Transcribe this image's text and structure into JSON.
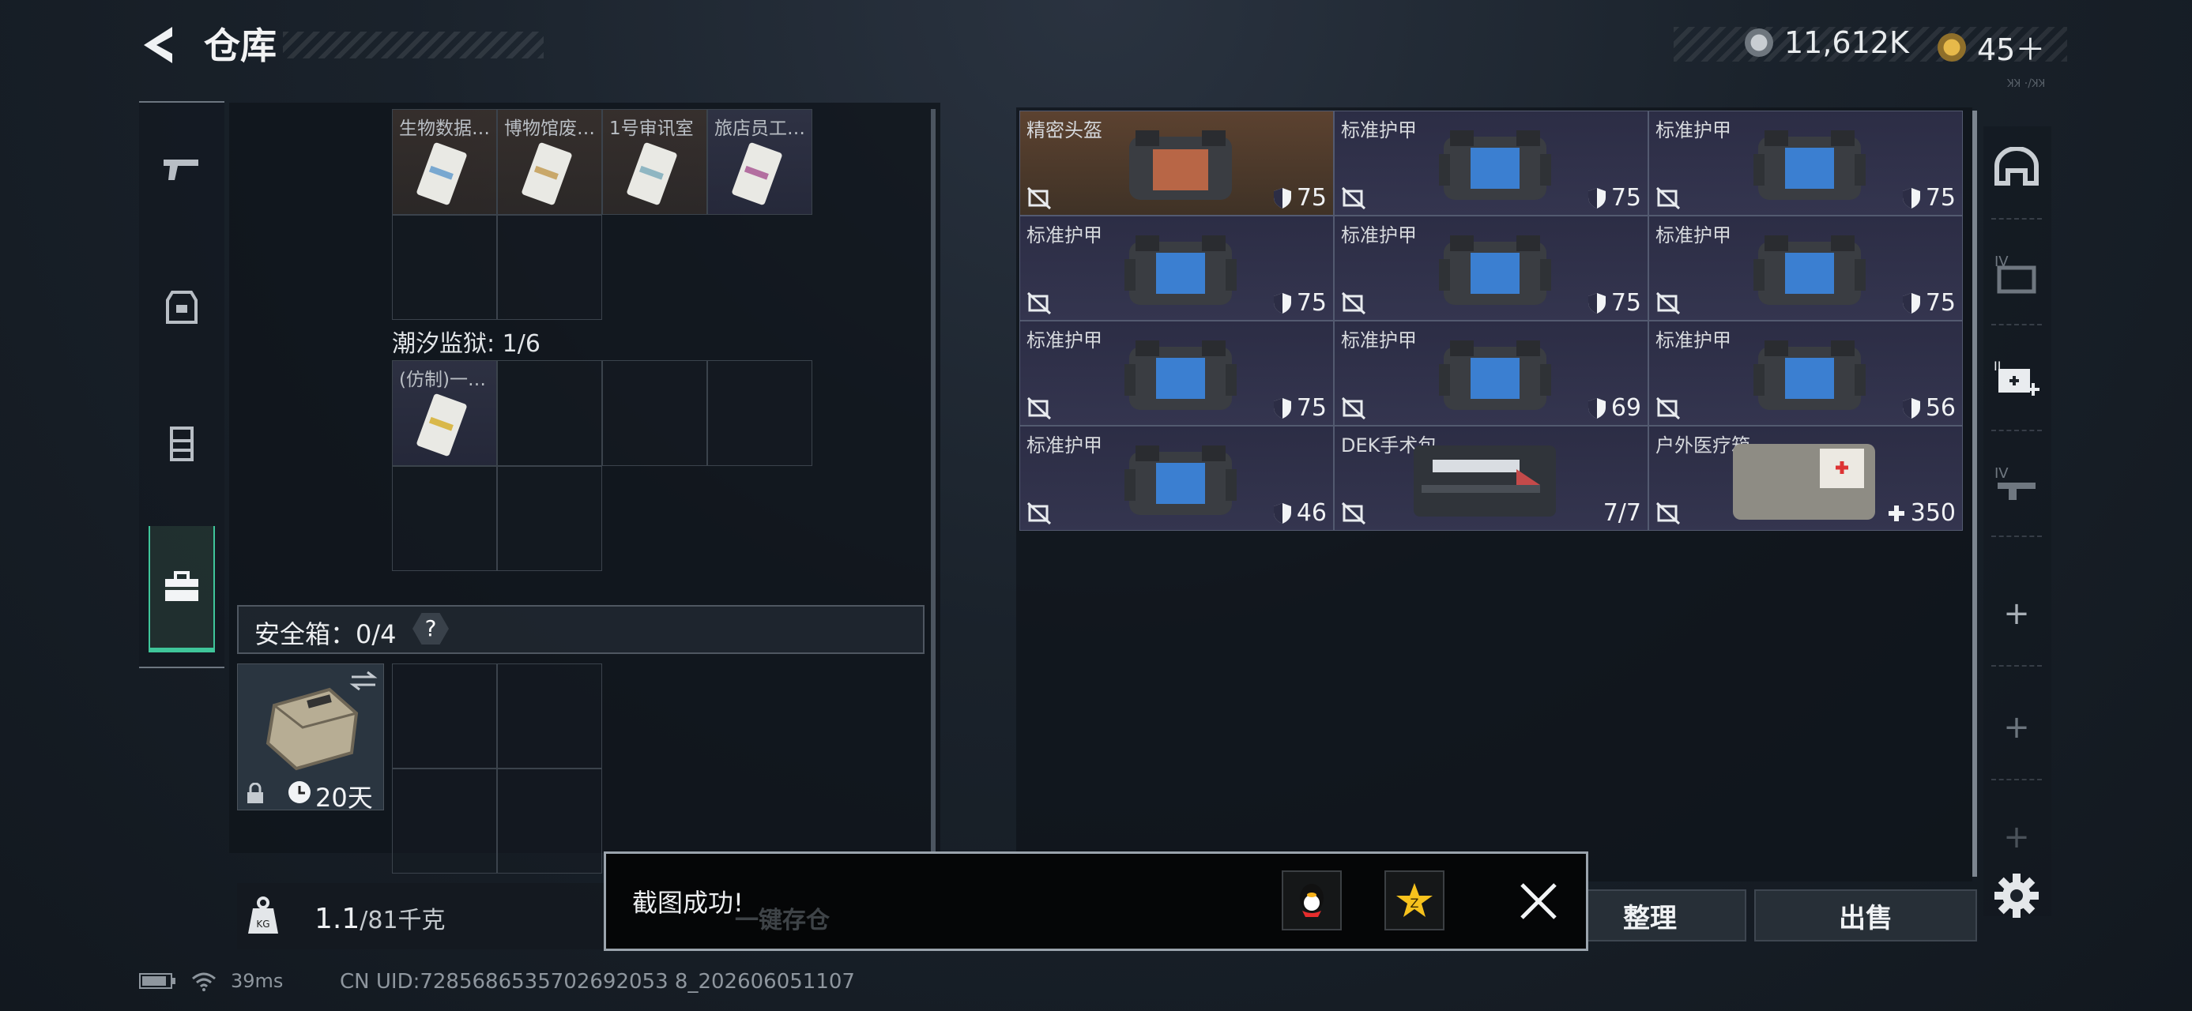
{
  "header": {
    "title": "仓库"
  },
  "currency": {
    "primary": "11,612K",
    "secondary": "45＋"
  },
  "corner_text": "ꞰꞰ ·/ꞰꞰ",
  "nav": {
    "items": [
      "pistol-icon",
      "backpack-icon",
      "chest-rig-icon",
      "toolbox-icon"
    ],
    "active": 3
  },
  "left_panel": {
    "key_cards": [
      "生物数据…",
      "博物馆废…",
      "1号审讯室",
      "旅店员工…"
    ],
    "section2_label": "潮汐监狱: 1/6",
    "section2_cards": [
      "(仿制)一…"
    ],
    "safe_label": "安全箱：0/4",
    "safe_help": "?",
    "safe_duration": "20天",
    "weight_value": "1.1",
    "weight_unit": "/81千克"
  },
  "inventory": [
    {
      "name": "精密头盔",
      "value": "75",
      "type": "helmet"
    },
    {
      "name": "标准护甲",
      "value": "75",
      "type": "armor"
    },
    {
      "name": "标准护甲",
      "value": "75",
      "type": "armor"
    },
    {
      "name": "标准护甲",
      "value": "75",
      "type": "armor"
    },
    {
      "name": "标准护甲",
      "value": "75",
      "type": "armor"
    },
    {
      "name": "标准护甲",
      "value": "75",
      "type": "armor"
    },
    {
      "name": "标准护甲",
      "value": "75",
      "type": "armor"
    },
    {
      "name": "标准护甲",
      "value": "69",
      "type": "armor"
    },
    {
      "name": "标准护甲",
      "value": "56",
      "type": "armor"
    },
    {
      "name": "标准护甲",
      "value": "46",
      "type": "armor"
    },
    {
      "name": "DEK手术包",
      "value": "7/7",
      "type": "medkit"
    },
    {
      "name": "户外医疗箱",
      "value": "350",
      "type": "medbox"
    }
  ],
  "buttons": {
    "sort": "整理",
    "sell": "出售"
  },
  "toast": {
    "message": "截图成功!",
    "ghost": "一键存仓"
  },
  "status": {
    "ping": "39ms",
    "uid": "CN UID:7285686535702692053 8_202606051107"
  },
  "colors": {
    "accent": "#3fc59a",
    "helmet_bg": "#5c4230",
    "armor_bg": "#2c2d45"
  }
}
